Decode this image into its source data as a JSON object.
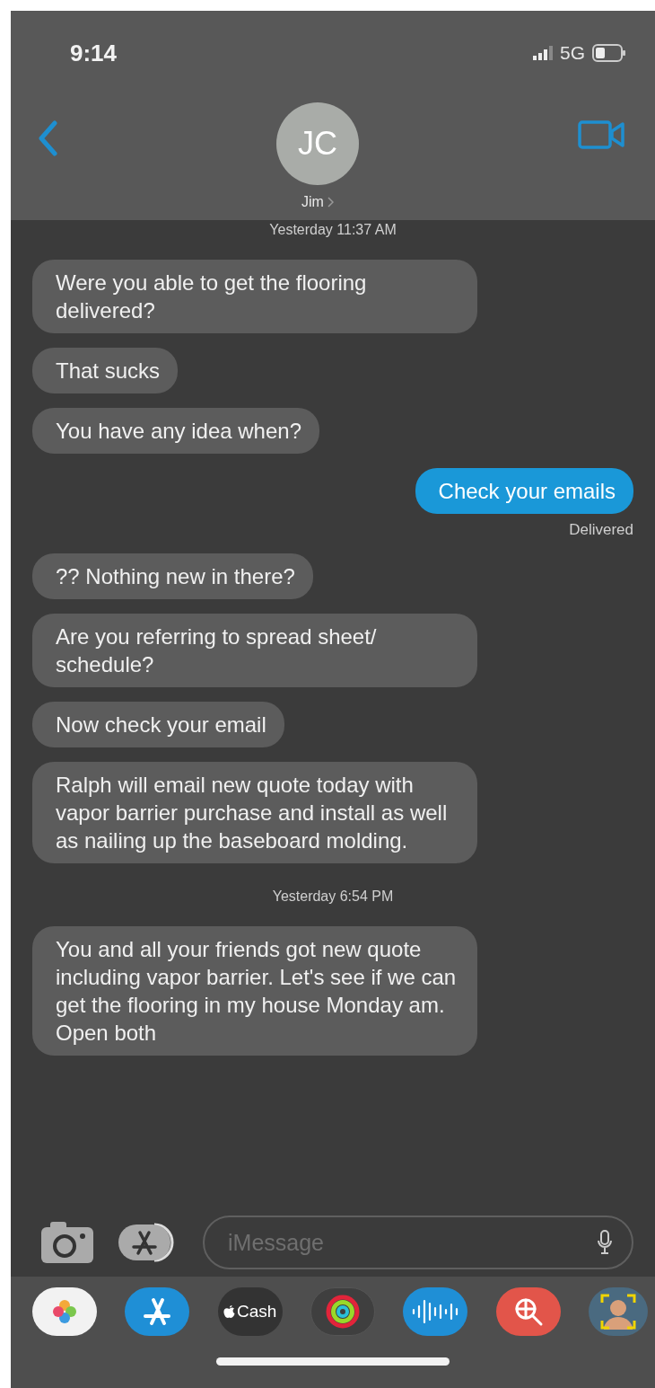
{
  "status_bar": {
    "time": "9:14",
    "network": "5G"
  },
  "header": {
    "initials": "JC",
    "name": "Jim"
  },
  "messages": [
    {
      "kind": "timestamp",
      "text": "Yesterday 11:37 AM"
    },
    {
      "kind": "received",
      "text": "Were you able to get the flooring delivered?"
    },
    {
      "kind": "received",
      "text": "That sucks"
    },
    {
      "kind": "received",
      "text": "You have any idea when?"
    },
    {
      "kind": "sent",
      "text": "Check your emails"
    },
    {
      "kind": "status",
      "text": "Delivered"
    },
    {
      "kind": "received",
      "text": "?? Nothing new in there?"
    },
    {
      "kind": "received",
      "text": "Are you referring to spread sheet/ schedule?"
    },
    {
      "kind": "received",
      "text": "Now check your email"
    },
    {
      "kind": "received",
      "text": "Ralph will email new quote today with vapor barrier purchase and install as well as nailing up the baseboard molding."
    },
    {
      "kind": "timestamp",
      "text": "Yesterday 6:54 PM"
    },
    {
      "kind": "received",
      "text": "You and all your friends got new quote including vapor barrier. Let's see if we can get the flooring in my house Monday am. Open both"
    }
  ],
  "composer": {
    "placeholder": "iMessage"
  },
  "app_tray": [
    {
      "kind": "photos"
    },
    {
      "kind": "appstore"
    },
    {
      "kind": "cash",
      "label": "Cash"
    },
    {
      "kind": "activity"
    },
    {
      "kind": "audio"
    },
    {
      "kind": "images"
    },
    {
      "kind": "memoji"
    }
  ]
}
